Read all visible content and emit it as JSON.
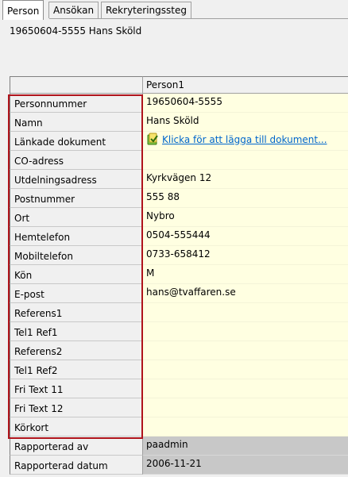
{
  "tabs": [
    {
      "label": "Person",
      "active": true
    },
    {
      "label": "Ansökan",
      "active": false
    },
    {
      "label": "Rekryteringssteg",
      "active": false
    }
  ],
  "identity": "19650604-5555 Hans Sköld",
  "grid": {
    "column_header": "Person1",
    "rows": [
      {
        "label": "Personnummer",
        "value": "19650604-5555"
      },
      {
        "label": "Namn",
        "value": "Hans Sköld"
      },
      {
        "label": "Länkade dokument",
        "value": "Klicka för att lägga till dokument...",
        "type": "link",
        "icon": "document-link-icon"
      },
      {
        "label": "CO-adress",
        "value": ""
      },
      {
        "label": "Utdelningsadress",
        "value": "Kyrkvägen 12"
      },
      {
        "label": "Postnummer",
        "value": "555 88"
      },
      {
        "label": "Ort",
        "value": "Nybro"
      },
      {
        "label": "Hemtelefon",
        "value": "0504-555444"
      },
      {
        "label": "Mobiltelefon",
        "value": "0733-658412"
      },
      {
        "label": "Kön",
        "value": "M"
      },
      {
        "label": "E-post",
        "value": "hans@tvaffaren.se"
      },
      {
        "label": "Referens1",
        "value": ""
      },
      {
        "label": "Tel1 Ref1",
        "value": ""
      },
      {
        "label": "Referens2",
        "value": ""
      },
      {
        "label": "Tel1 Ref2",
        "value": ""
      },
      {
        "label": "Fri Text 11",
        "value": ""
      },
      {
        "label": "Fri Text 12",
        "value": ""
      },
      {
        "label": "Körkort",
        "value": ""
      },
      {
        "label": "Rapporterad av",
        "value": "paadmin",
        "readonly": true
      },
      {
        "label": "Rapporterad datum",
        "value": "2006-11-21",
        "readonly": true
      }
    ]
  },
  "colors": {
    "editable_cell": "#ffffe1",
    "readonly_cell": "#c8c8c8",
    "highlight_border": "#b0141c",
    "link": "#0066cc"
  }
}
